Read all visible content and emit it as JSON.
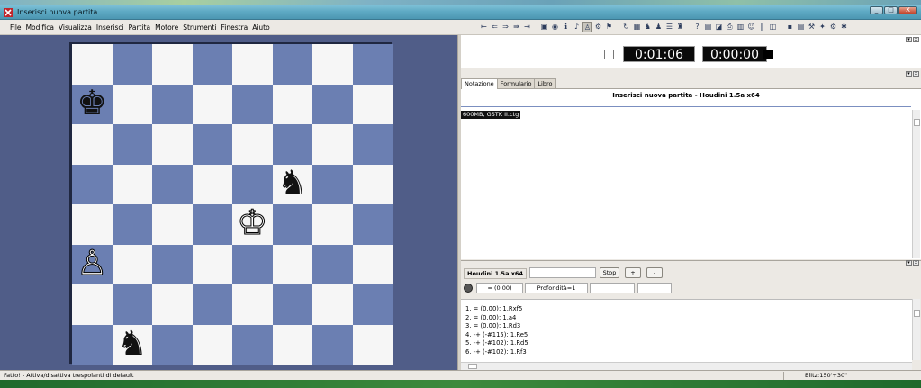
{
  "window": {
    "title": "Inserisci nuova partita",
    "controls": [
      "_",
      "□",
      "X"
    ]
  },
  "menu": [
    "File",
    "Modifica",
    "Visualizza",
    "Inserisci",
    "Partita",
    "Motore",
    "Strumenti",
    "Finestra",
    "Aiuto"
  ],
  "toolbar_icons": [
    {
      "name": "move-first-icon",
      "glyph": "⇤"
    },
    {
      "name": "move-back-icon",
      "glyph": "⇐"
    },
    {
      "name": "move-forward-icon",
      "glyph": "⇒"
    },
    {
      "name": "move-fast-icon",
      "glyph": "⇛"
    },
    {
      "name": "move-last-icon",
      "glyph": "⇥"
    },
    {
      "name": "separator",
      "glyph": ""
    },
    {
      "name": "folder-icon",
      "glyph": "▣"
    },
    {
      "name": "globe-icon",
      "glyph": "◉"
    },
    {
      "name": "info-icon",
      "glyph": "ℹ"
    },
    {
      "name": "notation-icon",
      "glyph": "♪"
    },
    {
      "name": "person-icon",
      "glyph": "♙"
    },
    {
      "name": "engine-icon",
      "glyph": "⚙"
    },
    {
      "name": "flag-icon",
      "glyph": "⚑"
    },
    {
      "name": "separator",
      "glyph": ""
    },
    {
      "name": "refresh-icon",
      "glyph": "↻"
    },
    {
      "name": "board-icon",
      "glyph": "▦"
    },
    {
      "name": "pieces-icon",
      "glyph": "♞"
    },
    {
      "name": "person-alt-icon",
      "glyph": "♟"
    },
    {
      "name": "list-icon",
      "glyph": "☰"
    },
    {
      "name": "trophy-icon",
      "glyph": "♜"
    },
    {
      "name": "separator",
      "glyph": ""
    },
    {
      "name": "question-icon",
      "glyph": "?"
    },
    {
      "name": "book-icon",
      "glyph": "▤"
    },
    {
      "name": "chart-icon",
      "glyph": "◪"
    },
    {
      "name": "print-icon",
      "glyph": "⎙"
    },
    {
      "name": "grid-icon",
      "glyph": "▥"
    },
    {
      "name": "user-icon",
      "glyph": "☺"
    },
    {
      "name": "bars-icon",
      "glyph": "‖"
    },
    {
      "name": "window-icon",
      "glyph": "◫"
    },
    {
      "name": "separator",
      "glyph": ""
    },
    {
      "name": "save-icon",
      "glyph": "▪"
    },
    {
      "name": "database-icon",
      "glyph": "▤"
    },
    {
      "name": "tools-icon",
      "glyph": "⚒"
    },
    {
      "name": "wrench-icon",
      "glyph": "✦"
    },
    {
      "name": "settings-icon",
      "glyph": "⚙"
    },
    {
      "name": "star-icon",
      "glyph": "✱"
    }
  ],
  "board": {
    "light_color": "#f6f6f6",
    "dark_color": "#6b7fb2",
    "pieces": [
      {
        "square": "a7",
        "row": 1,
        "col": 0,
        "glyph": "♚",
        "color": "black",
        "name": "black-king"
      },
      {
        "square": "f5",
        "row": 3,
        "col": 5,
        "glyph": "♞",
        "color": "black",
        "name": "black-knight-f5"
      },
      {
        "square": "e4",
        "row": 4,
        "col": 4,
        "glyph": "♔",
        "color": "white",
        "name": "white-king"
      },
      {
        "square": "a3",
        "row": 5,
        "col": 0,
        "glyph": "♙",
        "color": "white",
        "name": "white-pawn"
      },
      {
        "square": "b1",
        "row": 7,
        "col": 1,
        "glyph": "♞",
        "color": "black",
        "name": "black-knight-b1"
      }
    ]
  },
  "clocks": {
    "white": "0:01:06",
    "black": "0:00:00"
  },
  "tabs": [
    "Notazione",
    "Formulario",
    "Libro"
  ],
  "notation": {
    "title": "Inserisci nuova partita - Houdini 1.5a x64",
    "book": "600MB, GSTK II.ctg"
  },
  "engine": {
    "name": "Houdini 1.5a x64",
    "stop": "Stop",
    "plus": "+",
    "minus": "-",
    "eval": "= (0.00)",
    "depth": "Profondità=1",
    "lines": [
      "1. = (0.00): 1.Rxf5",
      "2. = (0.00): 1.a4",
      "3. = (0.00): 1.Rd3",
      "4. -+ (-#115): 1.Re5",
      "5. -+ (-#102): 1.Rd5",
      "6. -+ (-#102): 1.Rf3"
    ]
  },
  "status": {
    "text": "Fatto! - Attiva/disattiva trespolanti di default",
    "time_control": "Blitz:150'+30\""
  }
}
